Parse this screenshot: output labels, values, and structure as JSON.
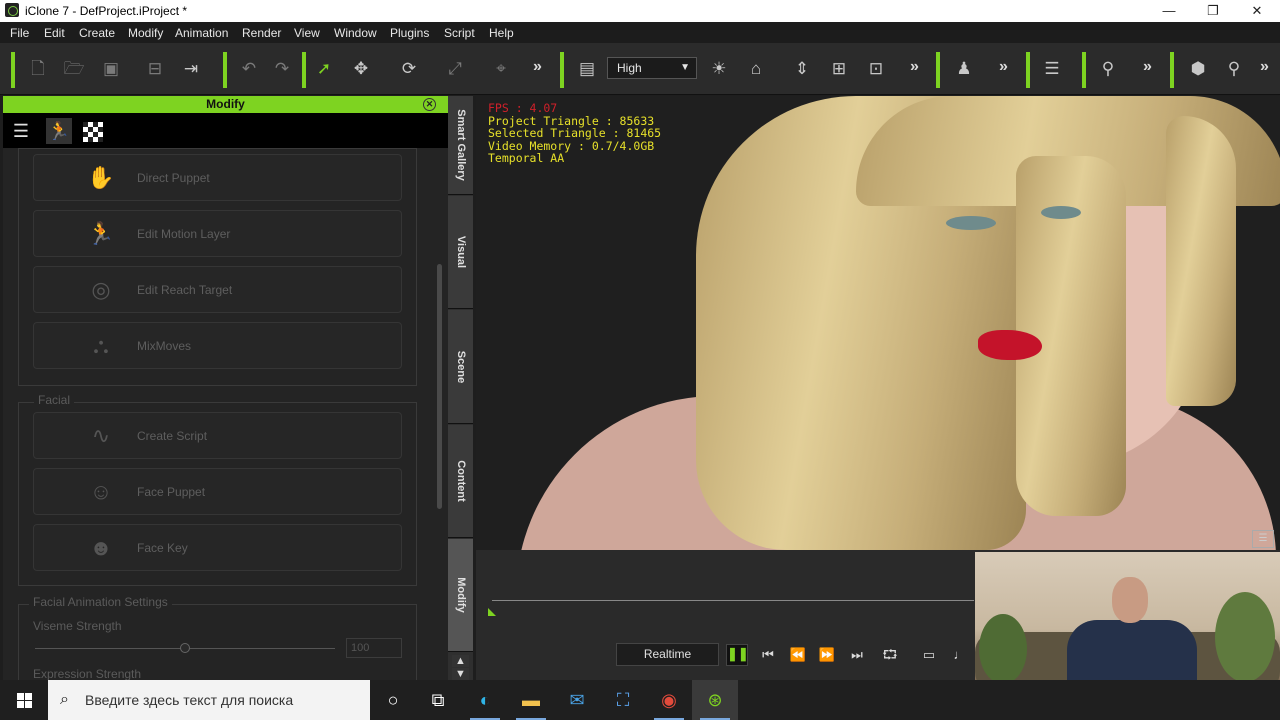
{
  "window": {
    "title": "iClone 7 - DefProject.iProject *",
    "minimize": "—",
    "restore": "❐",
    "close": "✕"
  },
  "menu": [
    "File",
    "Edit",
    "Create",
    "Modify",
    "Animation",
    "Render",
    "View",
    "Window",
    "Plugins",
    "Script",
    "Help"
  ],
  "toolbar": {
    "quality_value": "High",
    "more": "»"
  },
  "panel": {
    "title": "Modify",
    "buttons_top": [
      {
        "label": "Direct Puppet",
        "icon": "hand-icon"
      },
      {
        "label": "Edit Motion Layer",
        "icon": "figure-icon"
      },
      {
        "label": "Edit Reach Target",
        "icon": "target-icon"
      },
      {
        "label": "MixMoves",
        "icon": "nodes-icon"
      }
    ],
    "facial_legend": "Facial",
    "buttons_facial": [
      {
        "label": "Create Script",
        "icon": "wave-icon"
      },
      {
        "label": "Face Puppet",
        "icon": "face-icon"
      },
      {
        "label": "Face Key",
        "icon": "face-key-icon"
      }
    ],
    "facial_anim_legend": "Facial Animation Settings",
    "viseme_label": "Viseme Strength",
    "viseme_value": "100",
    "expression_label": "Expression Strength"
  },
  "side_tabs": [
    "Smart Gallery",
    "Visual",
    "Scene",
    "Content",
    "Modify"
  ],
  "viewport_stats": {
    "fps": "FPS : 4.07",
    "project_triangle": "Project Triangle : 85633",
    "selected_triangle": "Selected Triangle : 81465",
    "video_memory": "Video Memory : 0.7/4.0GB",
    "aa": "Temporal AA"
  },
  "playback": {
    "realtime_label": "Realtime"
  },
  "taskbar": {
    "search_placeholder": "Введите здесь текст для поиска"
  },
  "colors": {
    "accent": "#7ed321",
    "stat_text": "#e6e02a",
    "fps_text": "#d0202a"
  }
}
